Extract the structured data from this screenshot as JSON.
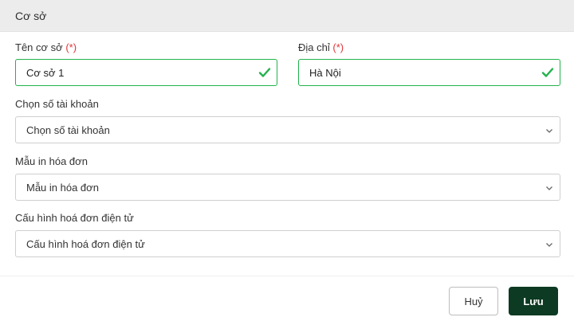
{
  "dialog": {
    "title": "Cơ sở"
  },
  "form": {
    "name": {
      "label": "Tên cơ sở",
      "required_mark": "(*)",
      "value": "Cơ sở 1",
      "valid_color": "#22b24c"
    },
    "address": {
      "label": "Địa chỉ",
      "required_mark": "(*)",
      "value": "Hà Nội",
      "valid_color": "#22b24c"
    },
    "account": {
      "label": "Chọn số tài khoản",
      "value": "Chọn số tài khoản"
    },
    "invoice_template": {
      "label": "Mẫu in hóa đơn",
      "value": "Mẫu in hóa đơn"
    },
    "einvoice_config": {
      "label": "Cấu hình hoá đơn điện tử",
      "value": "Cấu hình hoá đơn điện tử"
    }
  },
  "footer": {
    "cancel_label": "Huỷ",
    "save_label": "Lưu",
    "save_color": "#0c3a22"
  },
  "icons": {
    "valid": "check-icon",
    "dropdown": "chevron-down-icon"
  }
}
